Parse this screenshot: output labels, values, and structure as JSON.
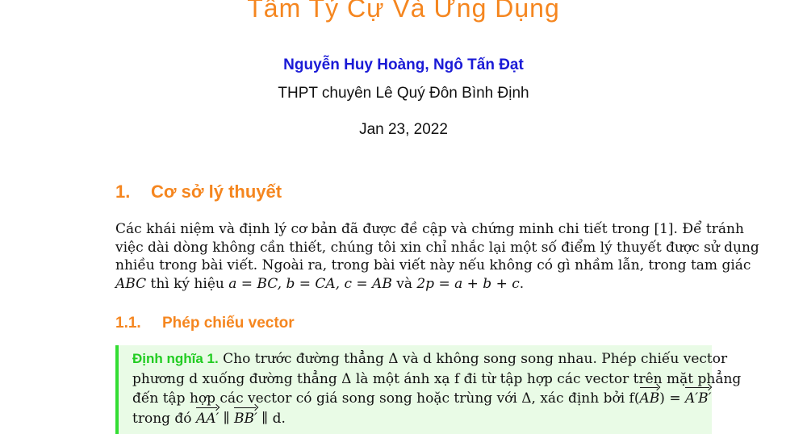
{
  "document": {
    "title": "Tâm Tỷ Cự Và Ứng Dụng",
    "authors": "Nguyễn Huy Hoàng, Ngô Tấn Đạt",
    "school": "THPT chuyên Lê Quý Đôn Bình Định",
    "date": "Jan 23, 2022"
  },
  "section1": {
    "number": "1.",
    "heading": "Cơ sở lý thuyết",
    "paragraph_lines": [
      "Các khái niệm và định lý cơ bản đã được đề cập và chứng minh chi tiết trong [1]. Để tránh",
      "việc dài dòng không cần thiết, chúng tôi xin chỉ nhắc lại một số điểm lý thuyết được sử dụng",
      "nhiều trong bài viết. Ngoài ra, trong bài viết này nếu không có gì nhầm lẫn, trong tam giác"
    ],
    "line4": {
      "triangle": "ABC",
      "text_a": " thì ký hiệu ",
      "formula": "a = BC, b = CA, c = AB",
      "text_b": " và ",
      "perimeter": "2p = a + b + c",
      "end": "."
    }
  },
  "subsection": {
    "number": "1.1.",
    "heading": "Phép chiếu vector"
  },
  "definition": {
    "label": "Định nghĩa 1.",
    "line1": " Cho trước đường thẳng Δ và d không song song nhau. Phép chiếu vector",
    "line2": "phương d xuống đường thẳng Δ là một ánh xạ f đi từ tập hợp các vector trên mặt phẳng",
    "line3_text": "đến tập hợp các vector có giá song song hoặc trùng với Δ, xác định bởi f(",
    "line3_vec1": "AB",
    "line3_mid": ") = ",
    "line3_vec2": "A′B′",
    "line4_text": "trong đó ",
    "line4_vec1": "AA′",
    "line4_sep": " ∥ ",
    "line4_vec2": "BB′",
    "line4_end": " ∥ d."
  }
}
